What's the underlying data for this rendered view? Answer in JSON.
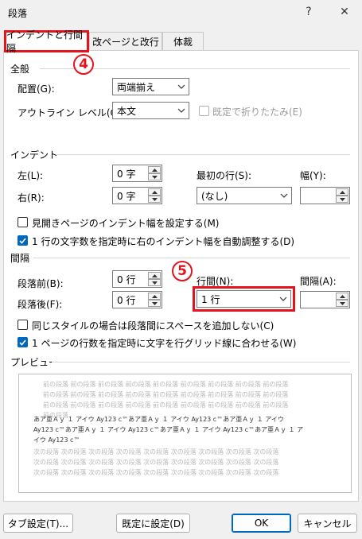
{
  "window": {
    "title": "段落",
    "help": "?",
    "close": "✕"
  },
  "tabs": [
    {
      "label": "インデントと行間隔"
    },
    {
      "label": "改ページと改行"
    },
    {
      "label": "体裁"
    }
  ],
  "annotations": {
    "step4": "4",
    "step5": "5"
  },
  "general": {
    "heading": "全般",
    "alignment_label": "配置(G):",
    "alignment_value": "両端揃え",
    "outline_label": "アウトライン レベル(O):",
    "outline_value": "本文",
    "collapsed_label": "既定で折りたたみ(E)"
  },
  "indent": {
    "heading": "インデント",
    "left_label": "左(L):",
    "left_value": "0 字",
    "right_label": "右(R):",
    "right_value": "0 字",
    "first_line_label": "最初の行(S):",
    "first_line_value": "(なし)",
    "width_label": "幅(Y):",
    "width_value": "",
    "mirror_label": "見開きページのインデント幅を設定する(M)",
    "auto_adjust_label": "1 行の文字数を指定時に右のインデント幅を自動調整する(D)"
  },
  "spacing": {
    "heading": "間隔",
    "before_label": "段落前(B):",
    "before_value": "0 行",
    "after_label": "段落後(F):",
    "after_value": "0 行",
    "line_spacing_label": "行間(N):",
    "line_spacing_value": "1 行",
    "at_label": "間隔(A):",
    "at_value": "",
    "no_space_same_style_label": "同じスタイルの場合は段落間にスペースを追加しない(C)",
    "snap_grid_label": "1 ページの行数を指定時に文字を行グリッド線に合わせる(W)"
  },
  "preview": {
    "heading": "プレビュー",
    "prev_lines": [
      "前の段落 前の段落 前の段落 前の段落 前の段落 前の段落 前の段落 前の段落 前の段落",
      "前の段落 前の段落 前の段落 前の段落 前の段落 前の段落 前の段落 前の段落 前の段落",
      "前の段落 前の段落 前の段落 前の段落 前の段落 前の段落 前の段落 前の段落 前の段落",
      "前の段落"
    ],
    "sample_lines": [
      "あア亜Ａｙ １ アイウ Ay123 c™あア亜Ａｙ １ アイウ Ay123 c™あア亜Ａｙ １ アイウ",
      "Ay123 c™あア亜Ａｙ １ アイウ Ay123 c™あア亜Ａｙ １ アイウ Ay123 c™あア亜Ａｙ １ ア",
      "イウ Ay123 c™"
    ],
    "next_lines": [
      "次の段落 次の段落 次の段落 次の段落 次の段落 次の段落 次の段落 次の段落 次の段落",
      "次の段落 次の段落 次の段落 次の段落 次の段落 次の段落 次の段落 次の段落 次の段落",
      "次の段落 次の段落 次の段落 次の段落 次の段落 次の段落 次の段落 次の段落 次の段落"
    ]
  },
  "buttons": {
    "tabs": "タブ設定(T)...",
    "set_default": "既定に設定(D)",
    "ok": "OK",
    "cancel": "キャンセル"
  },
  "colors": {
    "highlight": "#e3141b",
    "accent": "#0067c0"
  }
}
